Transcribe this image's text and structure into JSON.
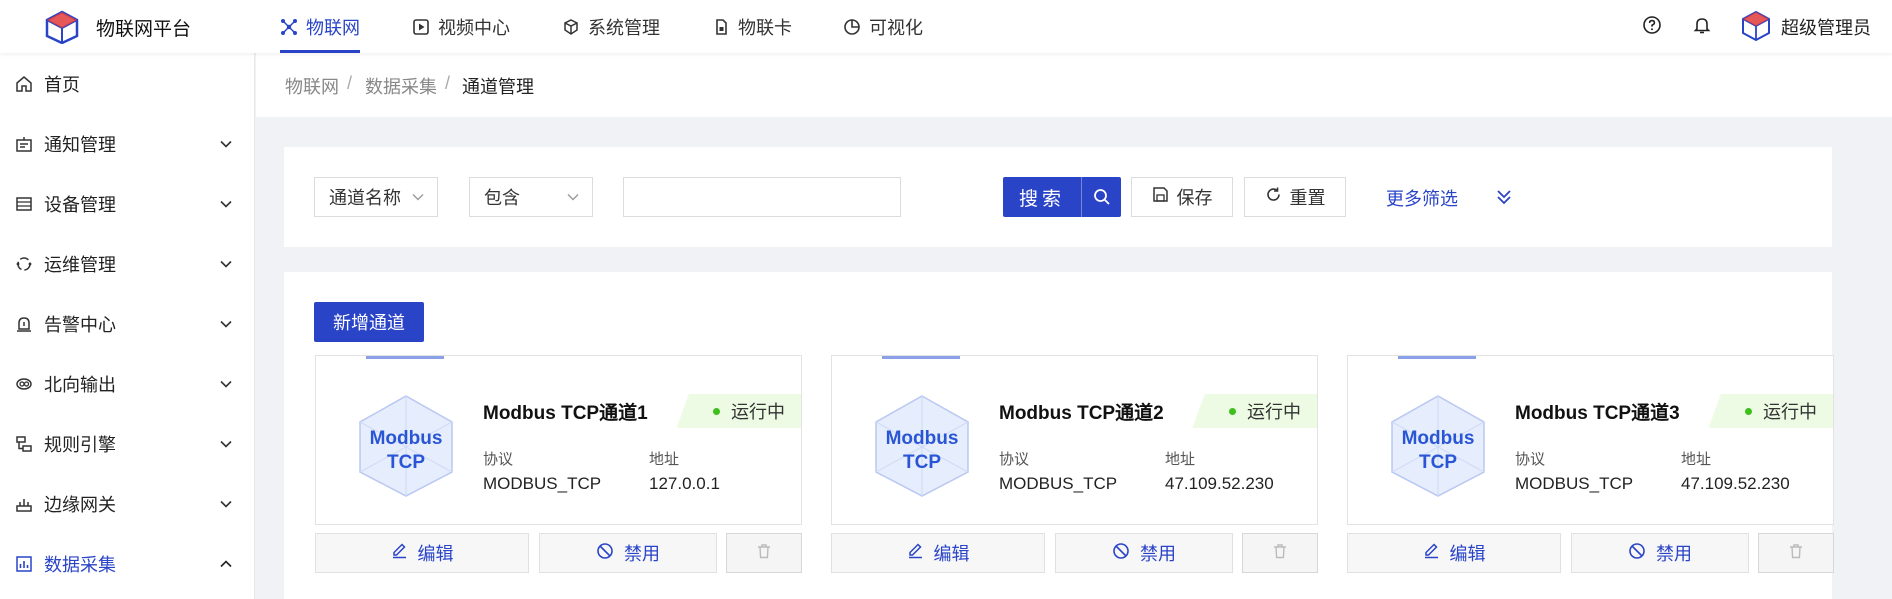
{
  "brand": {
    "name": "物联网平台",
    "logo_icon": "cube-logo-icon"
  },
  "topnav": [
    {
      "label": "物联网",
      "icon": "iot-icon",
      "active": true
    },
    {
      "label": "视频中心",
      "icon": "play-icon",
      "active": false
    },
    {
      "label": "系统管理",
      "icon": "box-icon",
      "active": false
    },
    {
      "label": "物联卡",
      "icon": "sim-card-icon",
      "active": false
    },
    {
      "label": "可视化",
      "icon": "pie-chart-icon",
      "active": false
    }
  ],
  "user": {
    "name": "超级管理员"
  },
  "sidebar": {
    "items": [
      {
        "label": "首页",
        "icon": "home-icon"
      },
      {
        "label": "通知管理",
        "icon": "notice-icon"
      },
      {
        "label": "设备管理",
        "icon": "device-icon"
      },
      {
        "label": "运维管理",
        "icon": "ops-icon"
      },
      {
        "label": "告警中心",
        "icon": "alarm-icon"
      },
      {
        "label": "北向输出",
        "icon": "output-icon"
      },
      {
        "label": "规则引擎",
        "icon": "rule-icon"
      },
      {
        "label": "边缘网关",
        "icon": "gateway-icon"
      },
      {
        "label": "数据采集",
        "icon": "data-collect-icon",
        "active": true
      }
    ]
  },
  "breadcrumb": [
    "物联网",
    "数据采集",
    "通道管理"
  ],
  "search": {
    "field_select": "通道名称",
    "op_select": "包含",
    "input_value": "",
    "search_label": "搜索",
    "save_label": "保存",
    "reset_label": "重置",
    "more_label": "更多筛选"
  },
  "main": {
    "add_label": "新增通道",
    "cards": [
      {
        "title": "Modbus TCP通道1",
        "status": "运行中",
        "protocol_key": "协议",
        "protocol": "MODBUS_TCP",
        "address_key": "地址",
        "address": "127.0.0.1",
        "hex_line1": "Modbus",
        "hex_line2": "TCP",
        "edit_label": "编辑",
        "disable_label": "禁用"
      },
      {
        "title": "Modbus TCP通道2",
        "status": "运行中",
        "protocol_key": "协议",
        "protocol": "MODBUS_TCP",
        "address_key": "地址",
        "address": "47.109.52.230",
        "hex_line1": "Modbus",
        "hex_line2": "TCP",
        "edit_label": "编辑",
        "disable_label": "禁用"
      },
      {
        "title": "Modbus TCP通道3",
        "status": "运行中",
        "protocol_key": "协议",
        "protocol": "MODBUS_TCP",
        "address_key": "地址",
        "address": "47.109.52.230",
        "hex_line1": "Modbus",
        "hex_line2": "TCP",
        "edit_label": "编辑",
        "disable_label": "禁用"
      }
    ]
  },
  "colors": {
    "accent": "#2a44c8",
    "status_ok": "#3cc01a",
    "status_bg": "#eefbe4"
  }
}
